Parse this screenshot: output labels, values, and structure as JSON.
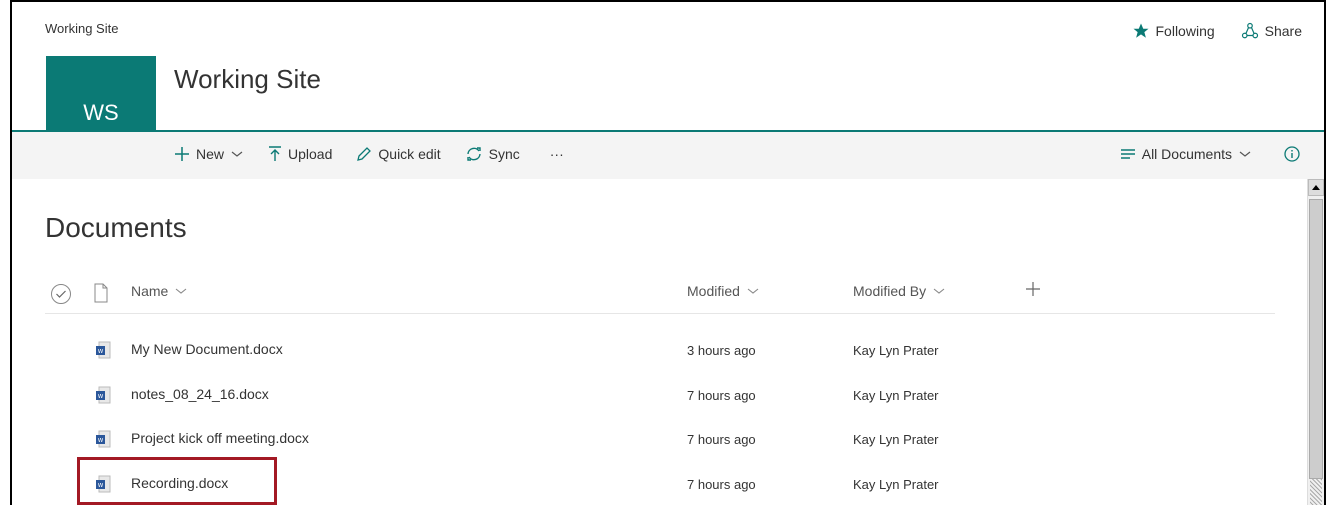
{
  "site": {
    "breadcrumb": "Working Site",
    "logo_text": "WS",
    "title": "Working Site",
    "accent_color": "#0b7a75"
  },
  "top_actions": {
    "following": "Following",
    "share": "Share"
  },
  "commands": {
    "new": "New",
    "upload": "Upload",
    "quick_edit": "Quick edit",
    "sync": "Sync",
    "more": "···",
    "view": "All Documents"
  },
  "library": {
    "title": "Documents",
    "columns": {
      "name": "Name",
      "modified": "Modified",
      "modified_by": "Modified By"
    },
    "rows": [
      {
        "name": "My New Document.docx",
        "modified": "3 hours ago",
        "modified_by": "Kay Lyn Prater"
      },
      {
        "name": "notes_08_24_16.docx",
        "modified": "7 hours ago",
        "modified_by": "Kay Lyn Prater"
      },
      {
        "name": "Project kick off meeting.docx",
        "modified": "7 hours ago",
        "modified_by": "Kay Lyn Prater"
      },
      {
        "name": "Recording.docx",
        "modified": "7 hours ago",
        "modified_by": "Kay Lyn Prater"
      }
    ]
  },
  "annotation_color": "#a31924"
}
